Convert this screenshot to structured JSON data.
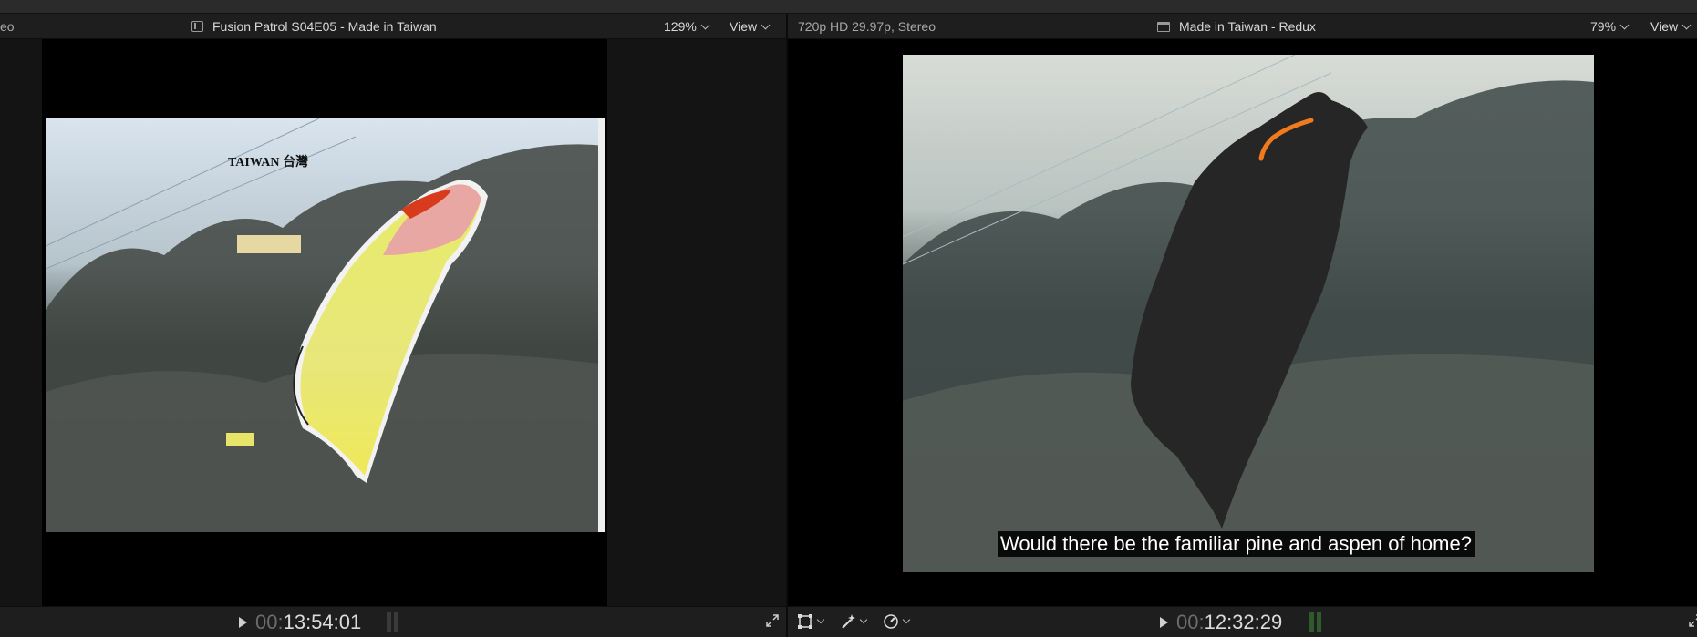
{
  "left_viewer": {
    "format_fragment": "eo",
    "title": "Fusion Patrol S04E05 - Made in Taiwan",
    "zoom": "129%",
    "view_label": "View",
    "timecode_prefix": "00:",
    "timecode_main": "13:54:01",
    "map_label": "TAIWAN 台灣"
  },
  "right_viewer": {
    "format": "720p HD 29.97p, Stereo",
    "title": "Made in Taiwan - Redux",
    "zoom": "79%",
    "view_label": "View",
    "timecode_prefix": "00:",
    "timecode_main": "12:32:29",
    "subtitle": "Would there be the familiar pine and aspen of home?"
  },
  "icons": {
    "clip": "film-clip-icon",
    "project": "clapperboard-icon",
    "transform": "transform-icon",
    "enhance": "magic-wand-icon",
    "retime": "retime-speed-icon",
    "fullscreen": "fullscreen-icon",
    "play": "play-icon"
  },
  "colors": {
    "accent_orange": "#f07a1e",
    "map_red": "#d83a1c",
    "map_pink": "#e8a7a2",
    "map_yellow": "#e2e56a"
  }
}
